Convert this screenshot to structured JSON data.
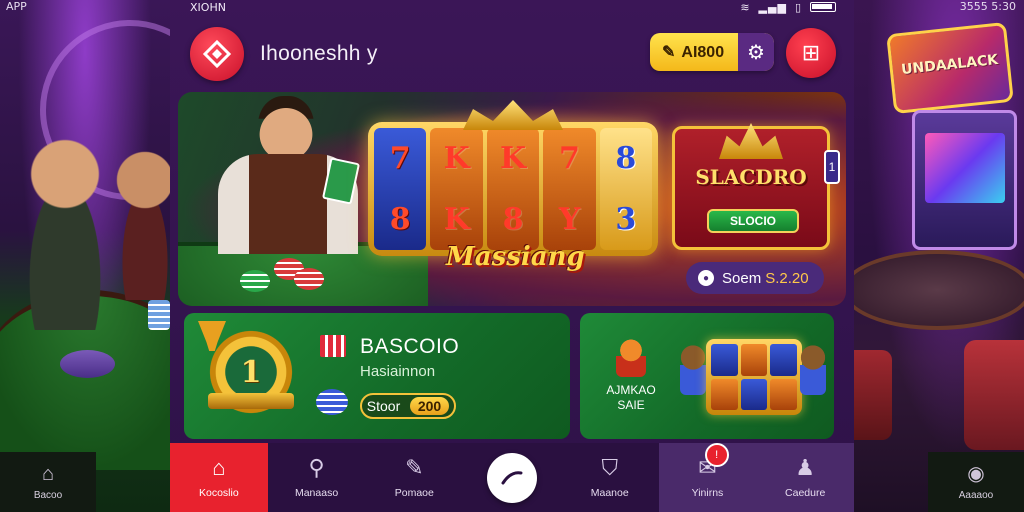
{
  "background": {
    "left_status": "APP",
    "right_status": "3555 5:30",
    "left_nav_label": "Bacoo",
    "right_nav_label": "Aaaaoo",
    "arcade_sign": "UNDAALACK"
  },
  "statusbar": {
    "time": "XIOHN",
    "icons": "wifi signal battery"
  },
  "header": {
    "app_name": "Ihooneshh y",
    "coins": "AI800",
    "colors": {
      "accent": "#e8222e",
      "coin": "#f4b81a",
      "bg": "#2e1248"
    }
  },
  "hero": {
    "reel_symbols": [
      [
        "7",
        "8"
      ],
      [
        "K",
        "K"
      ],
      [
        "K",
        "8"
      ],
      [
        "7",
        "Y"
      ],
      [
        "8",
        "3"
      ]
    ],
    "brand": "Massiang",
    "jackpot_title": "SLACDRO",
    "jackpot_button": "SLOCIO",
    "balance_label": "Soem",
    "balance_amount": "S.2.20"
  },
  "promos": {
    "left": {
      "medal_number": "1",
      "title": "BASCOIO",
      "subtitle": "Hasiainnon",
      "button_label": "Stoor",
      "button_value": "200"
    },
    "right": {
      "text": "AJMKAO SAIE"
    }
  },
  "bottom_nav": {
    "items": [
      {
        "label": "Kocoslio",
        "icon": "home-icon"
      },
      {
        "label": "Manaaso",
        "icon": "search-icon"
      },
      {
        "label": "Pomaoe",
        "icon": "edit-icon"
      },
      {
        "label": "",
        "icon": "refresh-icon"
      },
      {
        "label": "Maanoe",
        "icon": "shield-icon"
      },
      {
        "label": "Yinirns",
        "icon": "chat-icon"
      },
      {
        "label": "Caedure",
        "icon": "user-icon"
      }
    ],
    "badge": "!"
  }
}
